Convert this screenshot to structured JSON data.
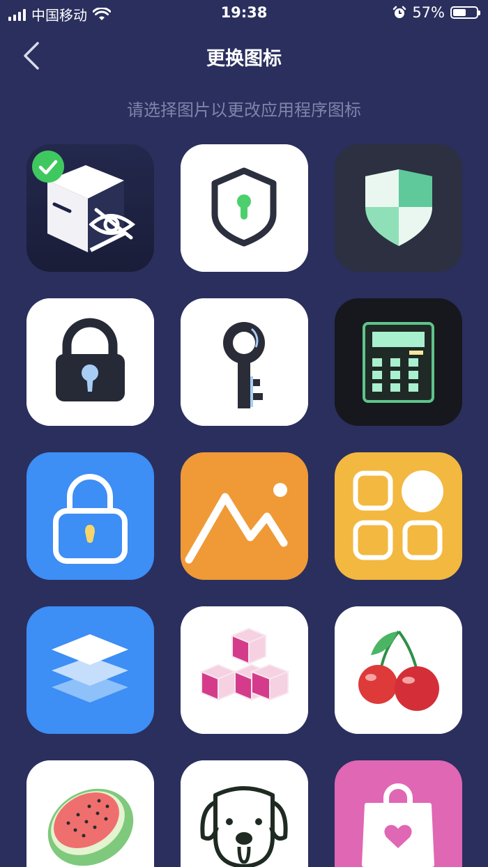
{
  "status_bar": {
    "carrier": "中国移动",
    "time": "19:38",
    "battery_percent": "57%",
    "battery_level": 0.57,
    "icons": [
      "signal-icon",
      "wifi-icon",
      "alarm-icon",
      "battery-icon"
    ]
  },
  "nav": {
    "title": "更换图标",
    "back_icon": "chevron-left-icon"
  },
  "subtitle": "请选择图片以更改应用程序图标",
  "colors": {
    "background": "#2a2f5e",
    "subtitle": "#7f84aa",
    "selected_check": "#3fc85f"
  },
  "icons": [
    {
      "name": "hidden-box",
      "selected": true
    },
    {
      "name": "shield-keyhole"
    },
    {
      "name": "green-shield"
    },
    {
      "name": "padlock-dark"
    },
    {
      "name": "key"
    },
    {
      "name": "calculator"
    },
    {
      "name": "padlock-blue"
    },
    {
      "name": "mountain-photo"
    },
    {
      "name": "app-grid"
    },
    {
      "name": "layers"
    },
    {
      "name": "cubes"
    },
    {
      "name": "cherries"
    },
    {
      "name": "watermelon"
    },
    {
      "name": "dog"
    },
    {
      "name": "shopping-bag-heart"
    }
  ]
}
